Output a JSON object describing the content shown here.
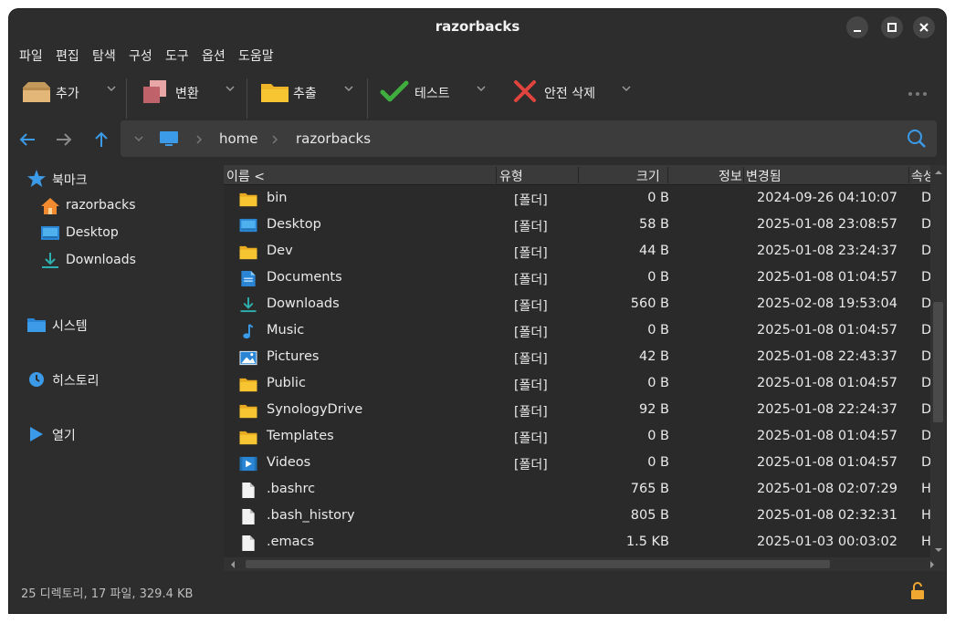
{
  "window": {
    "title": "razorbacks"
  },
  "menu": [
    "파일",
    "편집",
    "탐색",
    "구성",
    "도구",
    "옵션",
    "도움말"
  ],
  "toolbar": {
    "add": "추가",
    "convert": "변환",
    "extract": "추출",
    "test": "테스트",
    "secure_delete": "안전 삭제"
  },
  "location": {
    "crumbs": [
      "home",
      "razorbacks"
    ]
  },
  "sidebar": {
    "bookmarks_label": "북마크",
    "bookmarks": [
      "razorbacks",
      "Desktop",
      "Downloads"
    ],
    "system": "시스템",
    "history": "히스토리",
    "open": "열기"
  },
  "columns": {
    "name": "이름 <",
    "type": "유형",
    "size": "크기",
    "info": "정보",
    "modified": "변경됨",
    "attributes": "속성"
  },
  "files": [
    {
      "name": "bin",
      "type": "[폴더]",
      "size": "0 B",
      "modified": "2024-09-26 04:10:07",
      "attr": "DA",
      "icon": "folder-icon"
    },
    {
      "name": "Desktop",
      "type": "[폴더]",
      "size": "58 B",
      "modified": "2025-01-08 23:08:57",
      "attr": "DA",
      "icon": "desktop-folder-icon"
    },
    {
      "name": "Dev",
      "type": "[폴더]",
      "size": "44 B",
      "modified": "2025-01-08 23:24:37",
      "attr": "DA",
      "icon": "folder-icon"
    },
    {
      "name": "Documents",
      "type": "[폴더]",
      "size": "0 B",
      "modified": "2025-01-08 01:04:57",
      "attr": "DA",
      "icon": "documents-icon"
    },
    {
      "name": "Downloads",
      "type": "[폴더]",
      "size": "560 B",
      "modified": "2025-02-08 19:53:04",
      "attr": "DA",
      "icon": "downloads-icon"
    },
    {
      "name": "Music",
      "type": "[폴더]",
      "size": "0 B",
      "modified": "2025-01-08 01:04:57",
      "attr": "DA",
      "icon": "music-icon"
    },
    {
      "name": "Pictures",
      "type": "[폴더]",
      "size": "42 B",
      "modified": "2025-01-08 22:43:37",
      "attr": "DA",
      "icon": "pictures-icon"
    },
    {
      "name": "Public",
      "type": "[폴더]",
      "size": "0 B",
      "modified": "2025-01-08 01:04:57",
      "attr": "DA",
      "icon": "folder-icon"
    },
    {
      "name": "SynologyDrive",
      "type": "[폴더]",
      "size": "92 B",
      "modified": "2025-01-08 22:24:37",
      "attr": "DA",
      "icon": "folder-icon"
    },
    {
      "name": "Templates",
      "type": "[폴더]",
      "size": "0 B",
      "modified": "2025-01-08 01:04:57",
      "attr": "DA",
      "icon": "folder-icon"
    },
    {
      "name": "Videos",
      "type": "[폴더]",
      "size": "0 B",
      "modified": "2025-01-08 01:04:57",
      "attr": "DA",
      "icon": "videos-icon"
    },
    {
      "name": ".bashrc",
      "type": "",
      "size": "765 B",
      "modified": "2025-01-08 02:07:29",
      "attr": "HA",
      "icon": "file-icon"
    },
    {
      "name": ".bash_history",
      "type": "",
      "size": "805 B",
      "modified": "2025-01-08 02:32:31",
      "attr": "HA",
      "icon": "file-icon"
    },
    {
      "name": ".emacs",
      "type": "",
      "size": "1.5 KB",
      "modified": "2025-01-03 00:03:02",
      "attr": "HA",
      "icon": "file-icon"
    }
  ],
  "status": {
    "summary": "25 디렉토리, 17 파일, 329.4 KB"
  },
  "colors": {
    "folder": "#f7c531",
    "accent": "#3b9be8",
    "check": "#3fae3f",
    "cross": "#e0443e"
  }
}
